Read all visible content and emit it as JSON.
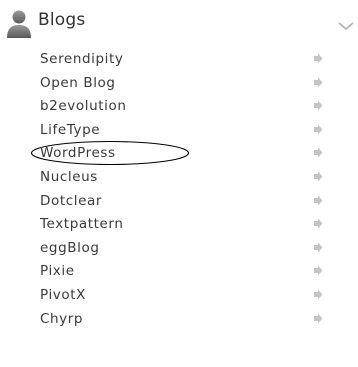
{
  "header": {
    "title": "Blogs",
    "icon": "user-icon",
    "chevron_icon": "chevron-down-icon"
  },
  "items": [
    {
      "label": "Serendipity",
      "icon": "arrow-right-icon"
    },
    {
      "label": "Open Blog",
      "icon": "arrow-right-icon"
    },
    {
      "label": "b2evolution",
      "icon": "arrow-right-icon"
    },
    {
      "label": "LifeType",
      "icon": "arrow-right-icon"
    },
    {
      "label": "WordPress",
      "icon": "arrow-right-icon",
      "circled": true
    },
    {
      "label": "Nucleus",
      "icon": "arrow-right-icon"
    },
    {
      "label": "Dotclear",
      "icon": "arrow-right-icon"
    },
    {
      "label": "Textpattern",
      "icon": "arrow-right-icon"
    },
    {
      "label": "eggBlog",
      "icon": "arrow-right-icon"
    },
    {
      "label": "Pixie",
      "icon": "arrow-right-icon"
    },
    {
      "label": "PivotX",
      "icon": "arrow-right-icon"
    },
    {
      "label": "Chyrp",
      "icon": "arrow-right-icon"
    }
  ],
  "colors": {
    "text": "#3a3a3a",
    "icon": "#707070",
    "arrow": "#c4c4c4",
    "ellipse": "#000000"
  }
}
